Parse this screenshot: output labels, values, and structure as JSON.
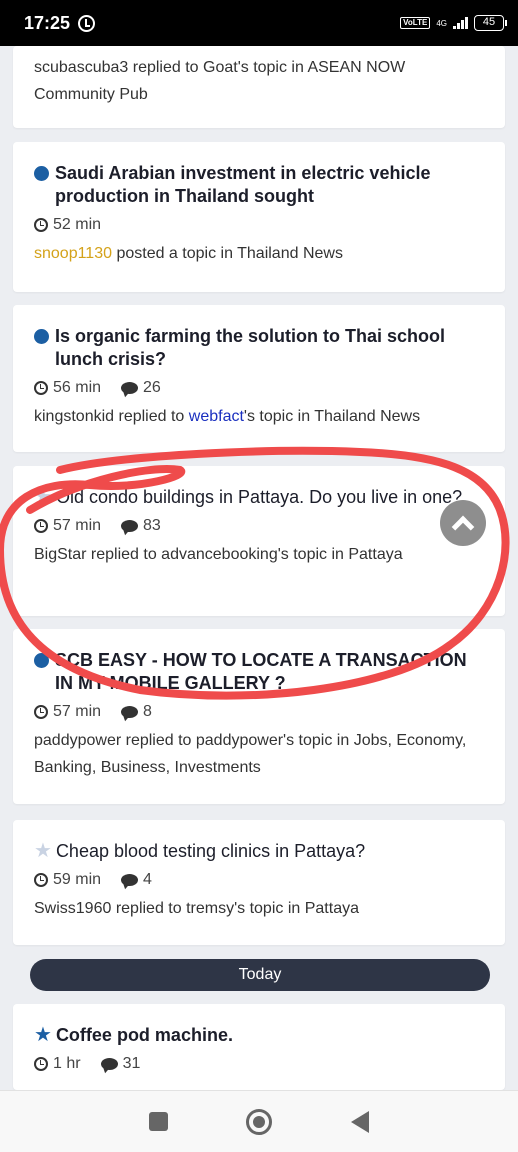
{
  "status_bar": {
    "time": "17:25",
    "volte": "VoLTE",
    "network": "4G",
    "battery": "45"
  },
  "cards": [
    {
      "activity_prefix": "scubascuba3 replied to Goat's topic in ASEAN NOW Community Pub"
    },
    {
      "title": "Saudi Arabian investment in electric vehicle production in Thailand sought",
      "time": "52 min",
      "author": "snoop1130",
      "activity_rest": " posted a topic in Thailand News"
    },
    {
      "title": "Is organic farming the solution to Thai school lunch crisis?",
      "time": "56 min",
      "comments": "26",
      "activity_start": "kingstonkid replied to ",
      "activity_link": "webfact",
      "activity_end": "'s topic in Thailand News"
    },
    {
      "title": "Old condo buildings in Pattaya. Do you live in one?",
      "time": "57 min",
      "comments": "83",
      "activity": "BigStar replied to advancebooking's topic in Pattaya"
    },
    {
      "title": "SCB EASY - HOW TO LOCATE A TRANSACTION IN MY MOBILE GALLERY ?",
      "time": "57 min",
      "comments": "8",
      "activity": "paddypower replied to paddypower's topic in Jobs, Economy, Banking, Business, Investments"
    },
    {
      "title": "Cheap blood testing clinics in Pattaya?",
      "time": "59 min",
      "comments": "4",
      "activity": "Swiss1960 replied to tremsy's topic in Pattaya"
    },
    {
      "title": "Coffee pod machine.",
      "time": "1 hr",
      "comments": "31"
    }
  ],
  "divider": {
    "label": "Today"
  },
  "icons": {
    "unread_dot": "circle-icon",
    "star_unread": "star-outline-icon",
    "star_read": "star-icon",
    "clock": "clock-icon",
    "comment": "comment-icon",
    "scroll_top": "chevron-up-icon"
  },
  "colors": {
    "accent_blue": "#1c5fa3",
    "author_gold": "#d4a21a",
    "link_blue": "#1a2fbf",
    "annotation_red": "#ef4b4b",
    "divider_bg": "#2e3546"
  }
}
